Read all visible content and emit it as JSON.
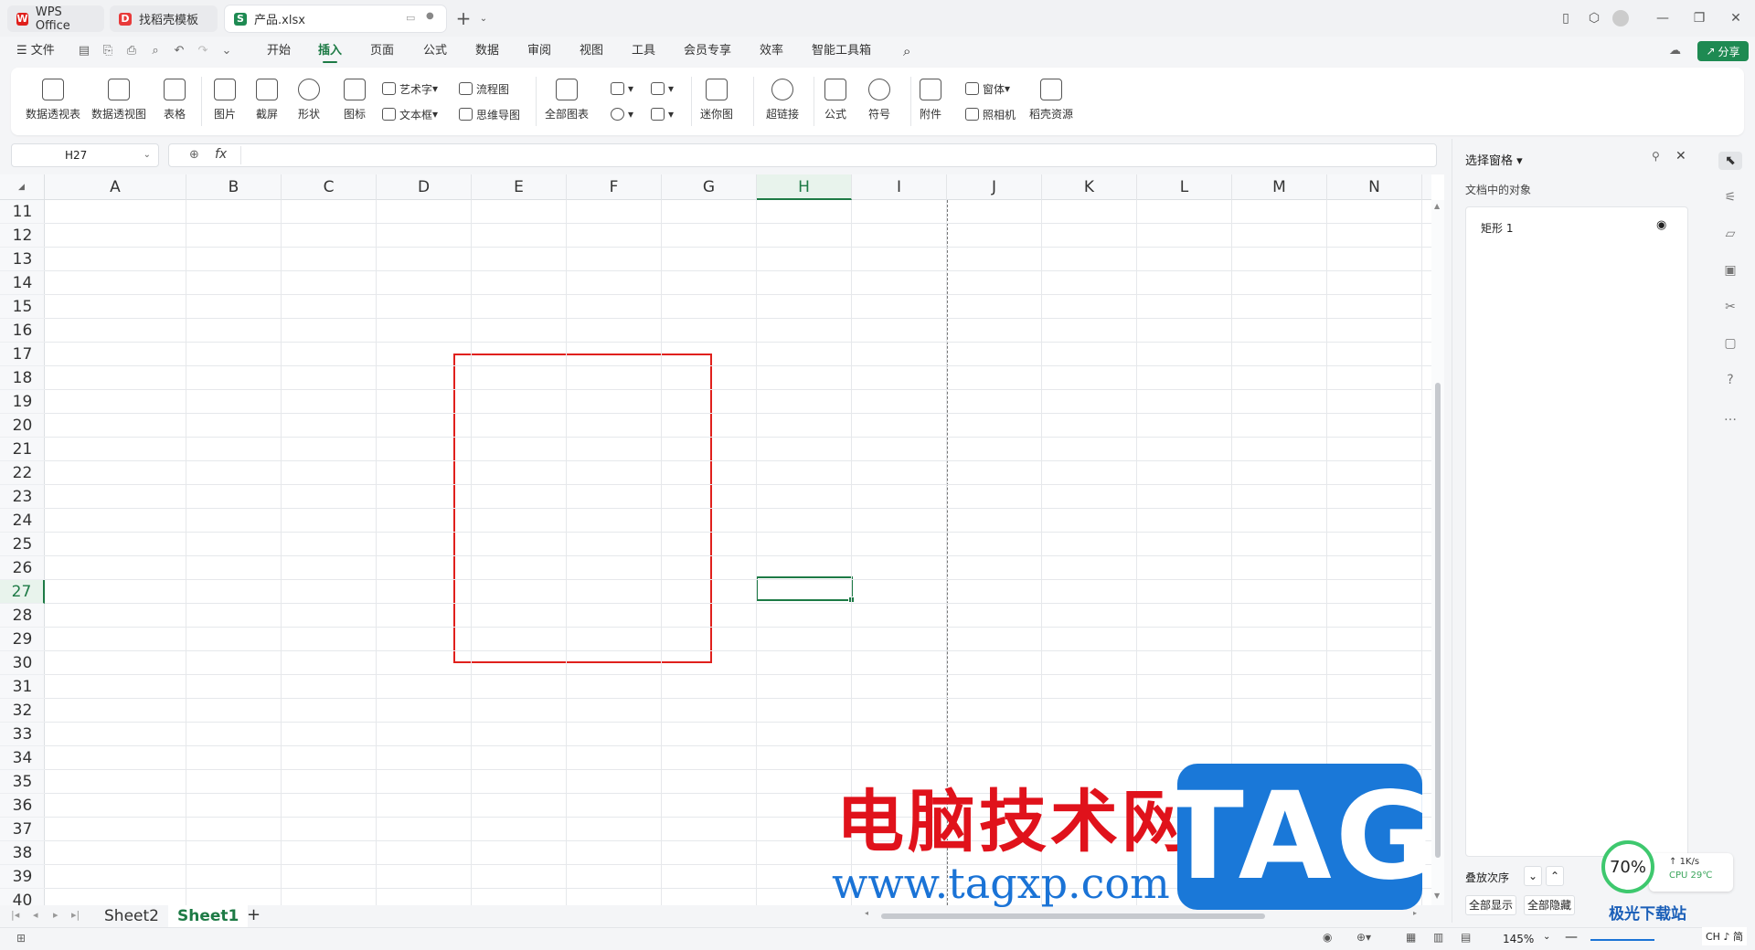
{
  "tabs": [
    {
      "label": "WPS Office",
      "icon": "wps-logo-icon"
    },
    {
      "label": "找稻壳模板",
      "icon": "docer-icon"
    },
    {
      "label": "产品.xlsx",
      "icon": "spreadsheet-icon"
    }
  ],
  "menu": {
    "file": "文件",
    "items": [
      "开始",
      "插入",
      "页面",
      "公式",
      "数据",
      "审阅",
      "视图",
      "工具",
      "会员专享",
      "效率",
      "智能工具箱"
    ],
    "active": "插入",
    "share": "分享"
  },
  "ribbon": {
    "large": [
      {
        "label": "数据透视表",
        "icon": "pivot-table-icon"
      },
      {
        "label": "数据透视图",
        "icon": "pivot-chart-icon"
      },
      {
        "label": "表格",
        "icon": "table-icon"
      },
      {
        "label": "图片",
        "icon": "picture-icon"
      },
      {
        "label": "截屏",
        "icon": "screenshot-icon"
      },
      {
        "label": "形状",
        "icon": "shapes-icon"
      },
      {
        "label": "图标",
        "icon": "icons-icon"
      },
      {
        "label": "全部图表",
        "icon": "all-charts-icon"
      },
      {
        "label": "迷你图",
        "icon": "sparkline-icon"
      },
      {
        "label": "超链接",
        "icon": "hyperlink-icon"
      },
      {
        "label": "公式",
        "icon": "formula-icon"
      },
      {
        "label": "符号",
        "icon": "symbol-icon"
      },
      {
        "label": "附件",
        "icon": "attachment-icon"
      },
      {
        "label": "稻壳资源",
        "icon": "docer-resource-icon"
      }
    ],
    "small": [
      {
        "label": "艺术字",
        "icon": "wordart-icon"
      },
      {
        "label": "文本框",
        "icon": "textbox-icon"
      },
      {
        "label": "流程图",
        "icon": "flowchart-icon"
      },
      {
        "label": "思维导图",
        "icon": "mindmap-icon"
      },
      {
        "label": "窗体",
        "icon": "form-icon"
      },
      {
        "label": "照相机",
        "icon": "camera-icon"
      }
    ]
  },
  "formula": {
    "cell_ref": "H27",
    "fx": "fx",
    "value": ""
  },
  "columns": [
    "A",
    "B",
    "C",
    "D",
    "E",
    "F",
    "G",
    "H",
    "I",
    "J",
    "K",
    "L",
    "M",
    "N"
  ],
  "rows": [
    "11",
    "12",
    "13",
    "14",
    "15",
    "16",
    "17",
    "18",
    "19",
    "20",
    "21",
    "22",
    "23",
    "24",
    "25",
    "26",
    "27",
    "28",
    "29",
    "30",
    "31",
    "32",
    "33",
    "34",
    "35",
    "36",
    "37",
    "38",
    "39",
    "40"
  ],
  "selected": {
    "column": "H",
    "row": "27"
  },
  "sheets": [
    "Sheet2",
    "Sheet1"
  ],
  "active_sheet": "Sheet1",
  "panel": {
    "title": "选择窗格",
    "subtitle": "文档中的对象",
    "objects": [
      "矩形 1"
    ],
    "order_label": "叠放次序",
    "show_all": "全部显示",
    "hide_all": "全部隐藏"
  },
  "status": {
    "zoom": "145%"
  },
  "overlay": {
    "watermark_cn": "电脑技术网",
    "watermark_url": "www.tagxp.com",
    "tag": "TAG",
    "cpu_percent": "70%",
    "net_speed": "1K/s",
    "cpu_temp": "CPU 29℃",
    "logo2": "极光下载站",
    "ime": "CH ♪ 简"
  },
  "colors": {
    "accent": "#1d7a45",
    "shape_border": "#e0201c",
    "share": "#1e8a52"
  }
}
